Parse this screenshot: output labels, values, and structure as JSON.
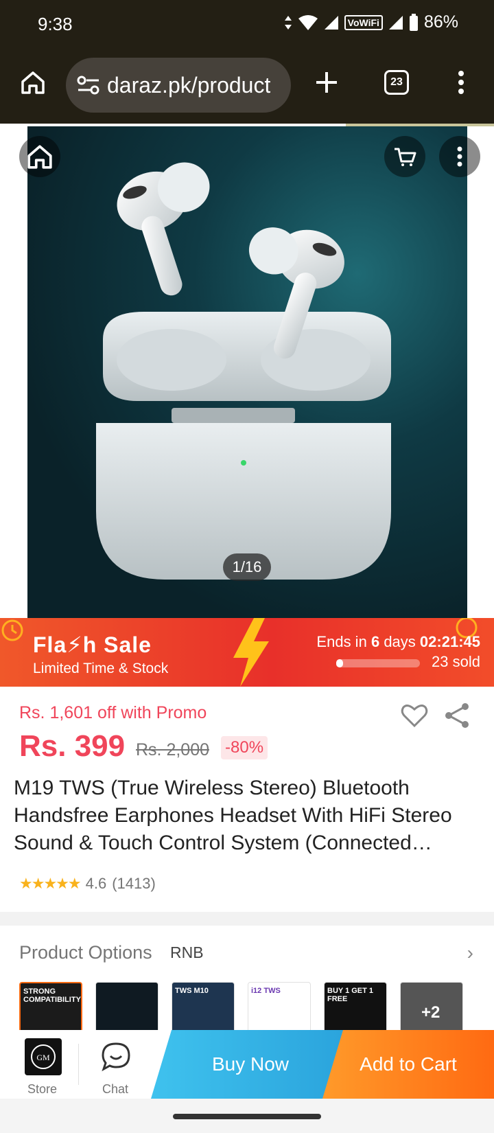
{
  "status_bar": {
    "time": "9:38",
    "network_label": "VoWiFi",
    "battery": "86%"
  },
  "browser": {
    "url": "daraz.pk/product",
    "tab_count": "23"
  },
  "gallery": {
    "counter": "1/16"
  },
  "flash_sale": {
    "title": "Fla⚡h Sale",
    "subtitle": "Limited Time & Stock",
    "ends_prefix": "Ends in",
    "days": "6",
    "days_label": "days",
    "countdown": "02:21:45",
    "sold_fraction": 0.08,
    "sold_text": "23 sold"
  },
  "pricing": {
    "promo_text": "Rs. 1,601 off with Promo",
    "price": "Rs. 399",
    "original_price": "Rs. 2,000",
    "discount": "-80%"
  },
  "product": {
    "title": "M19 TWS (True Wireless Stereo) Bluetooth Handsfree Earphones Headset With HiFi Stereo Sound & Touch Control System (Connected…",
    "rating": "4.6",
    "reviews": "(1413)"
  },
  "options": {
    "label": "Product Options",
    "selected": "RNB",
    "thumbnails": [
      {
        "label": "STRONG COMPATIBILITY",
        "bg": "#1b1b1b",
        "color": "#ffffff",
        "selected": true
      },
      {
        "label": "",
        "bg": "#0f1a22",
        "color": "#ffffff",
        "selected": false
      },
      {
        "label": "TWS M10",
        "bg": "#1e3550",
        "color": "#ffffff",
        "selected": false
      },
      {
        "label": "i12 TWS",
        "bg": "#ffffff",
        "color": "#6a38b0",
        "selected": false
      },
      {
        "label": "BUY 1 GET 1 FREE",
        "bg": "#111111",
        "color": "#ffffff",
        "selected": false
      },
      {
        "label": "+2",
        "bg": "#555555",
        "color": "#ffffff",
        "selected": false
      }
    ]
  },
  "bottom_bar": {
    "store_label": "Store",
    "chat_label": "Chat",
    "buy_now": "Buy Now",
    "add_to_cart": "Add to Cart"
  },
  "colors": {
    "accent": "#f0455a",
    "buy_now": "#2aa3dc",
    "add_to_cart": "#ff6a12",
    "flash": "#e8302a"
  }
}
